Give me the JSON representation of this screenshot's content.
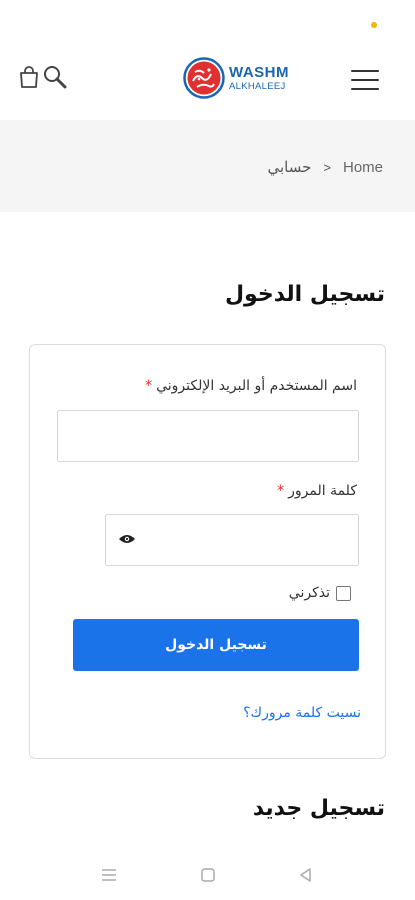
{
  "status": {
    "indicator_color": "#f5b400"
  },
  "header": {
    "logo": {
      "line1": "WASHM",
      "line2": "ALKHALEEJ",
      "brand_color": "#1b66b3",
      "mark_color": "#e03030"
    },
    "menu_icon": "hamburger-icon",
    "cart_icon": "shopping-bag-icon",
    "search_icon": "search-icon"
  },
  "breadcrumb": {
    "home": "Home",
    "separator": ">",
    "current": "حسابي"
  },
  "login": {
    "title": "تسجيل الدخول",
    "username_label": "اسم المستخدم أو البريد الإلكتروني",
    "username_value": "",
    "password_label": "كلمة المرور",
    "password_value": "",
    "required_mark": "*",
    "remember_label": "تذكرني",
    "remember_checked": false,
    "submit_label": "تسجيل الدخول",
    "forgot_link": "نسيت كلمة مرورك؟",
    "accent_color": "#1a73e8"
  },
  "register": {
    "title": "تسجيل جديد"
  },
  "nav_bar": {
    "buttons": [
      "recent-apps-icon",
      "home-icon",
      "back-icon"
    ]
  }
}
